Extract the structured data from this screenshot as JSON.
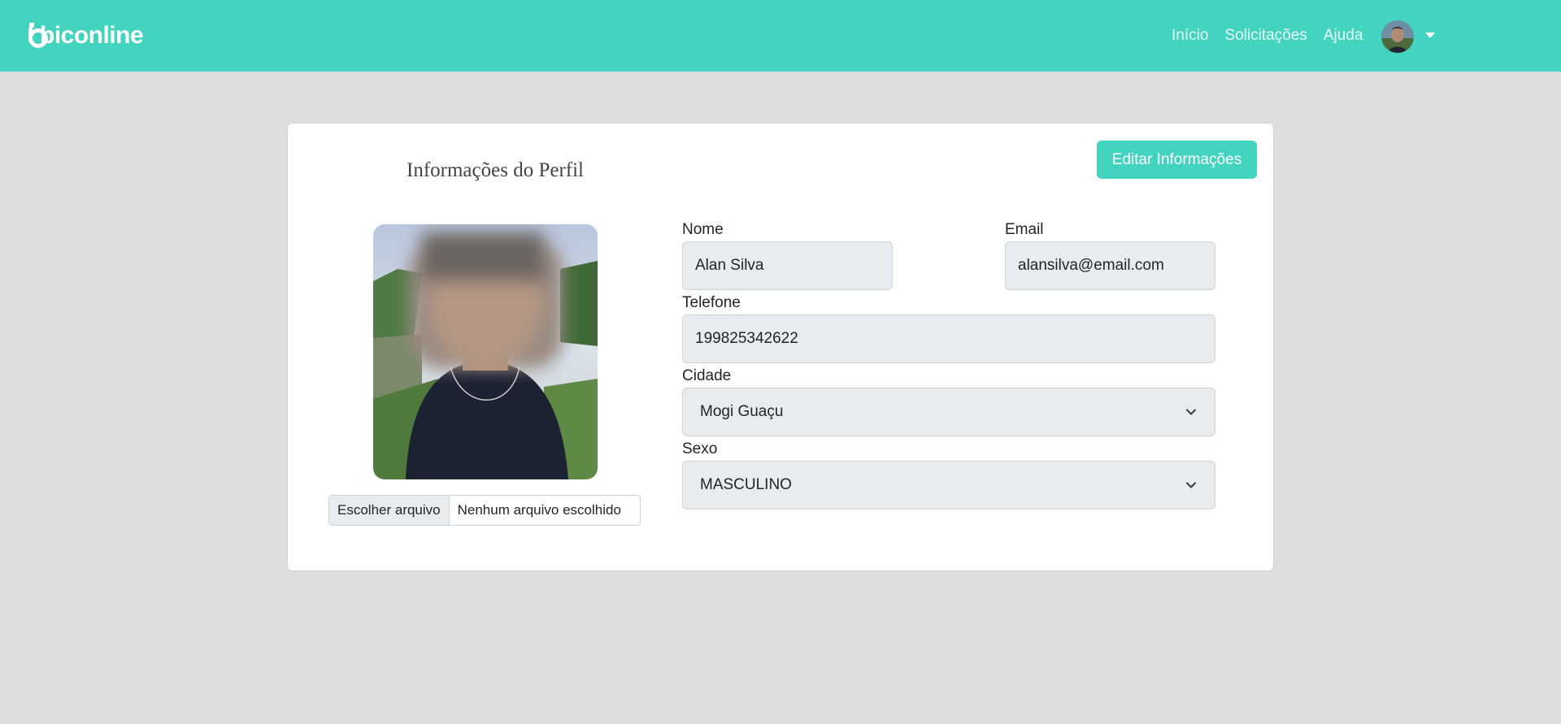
{
  "navbar": {
    "brand": "biconline",
    "links": [
      {
        "label": "Início"
      },
      {
        "label": "Solicitações"
      },
      {
        "label": "Ajuda"
      }
    ],
    "avatar_icon": "user-avatar",
    "dropdown_icon": "caret-down-icon"
  },
  "profile": {
    "title": "Informações do Perfil",
    "edit_button": "Editar Informações",
    "photo_icon": "profile-photo",
    "file_input": {
      "button": "Escolher arquivo",
      "status": "Nenhum arquivo escolhido"
    },
    "fields": {
      "nome": {
        "label": "Nome",
        "value": "Alan Silva"
      },
      "email": {
        "label": "Email",
        "value": "alansilva@email.com"
      },
      "telefone": {
        "label": "Telefone",
        "value": "199825342622"
      },
      "cidade": {
        "label": "Cidade",
        "value": "Mogi Guaçu"
      },
      "sexo": {
        "label": "Sexo",
        "value": "MASCULINO"
      }
    }
  },
  "colors": {
    "brand": "#42d4be",
    "background": "#dedede",
    "input_bg": "#e9ecef"
  }
}
